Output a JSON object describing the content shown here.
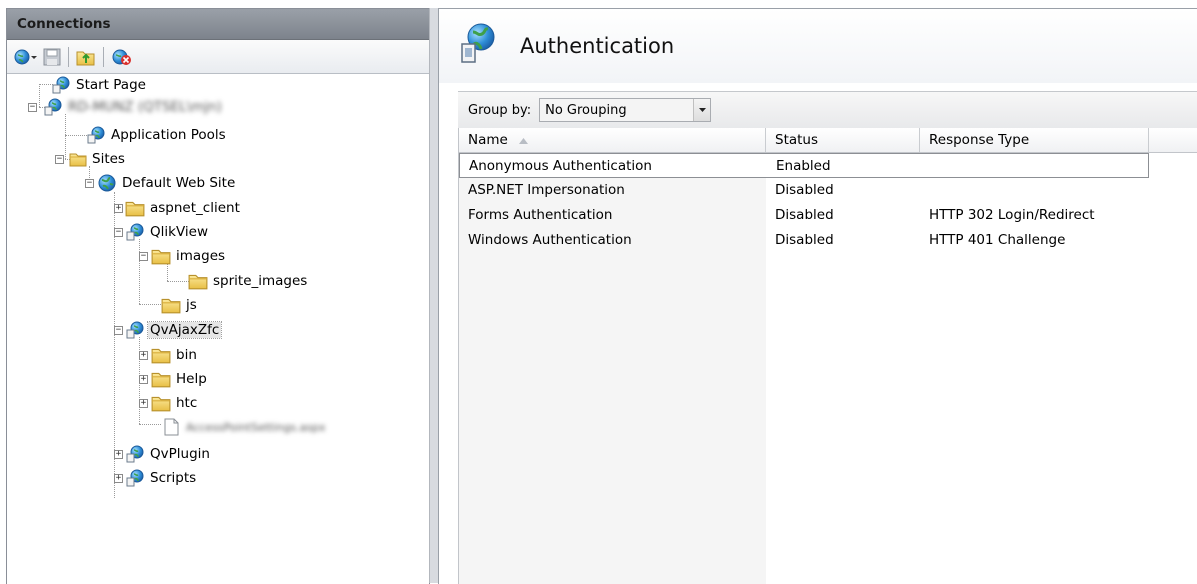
{
  "connections": {
    "title": "Connections",
    "toolbar": [
      "connect-icon",
      "save-icon",
      "up-folder-icon",
      "disconnect-icon"
    ],
    "tree": {
      "start_page": "Start Page",
      "server": "RD-MUNZ (QTSEL\\mjn)",
      "application_pools": "Application Pools",
      "sites": "Sites",
      "default_web_site": "Default Web Site",
      "aspnet_client": "aspnet_client",
      "qlikview": "QlikView",
      "images": "images",
      "sprite_images": "sprite_images",
      "js": "js",
      "qvajaxzfc": "QvAjaxZfc",
      "bin": "bin",
      "help": "Help",
      "htc": "htc",
      "config_file": "AccessPointSettings.aspx",
      "qvplugin": "QvPlugin",
      "scripts": "Scripts"
    }
  },
  "feature": {
    "title": "Authentication",
    "group_by_label": "Group by:",
    "group_by_value": "No Grouping",
    "columns": {
      "name": "Name",
      "status": "Status",
      "response_type": "Response Type"
    },
    "rows": [
      {
        "name": "Anonymous Authentication",
        "status": "Enabled",
        "response_type": ""
      },
      {
        "name": "ASP.NET Impersonation",
        "status": "Disabled",
        "response_type": ""
      },
      {
        "name": "Forms Authentication",
        "status": "Disabled",
        "response_type": "HTTP 302 Login/Redirect"
      },
      {
        "name": "Windows Authentication",
        "status": "Disabled",
        "response_type": "HTTP 401 Challenge"
      }
    ]
  },
  "colors": {
    "title_bar": "#8a9098",
    "folder": "#f4d46a",
    "globe": "#2f8fd8"
  }
}
